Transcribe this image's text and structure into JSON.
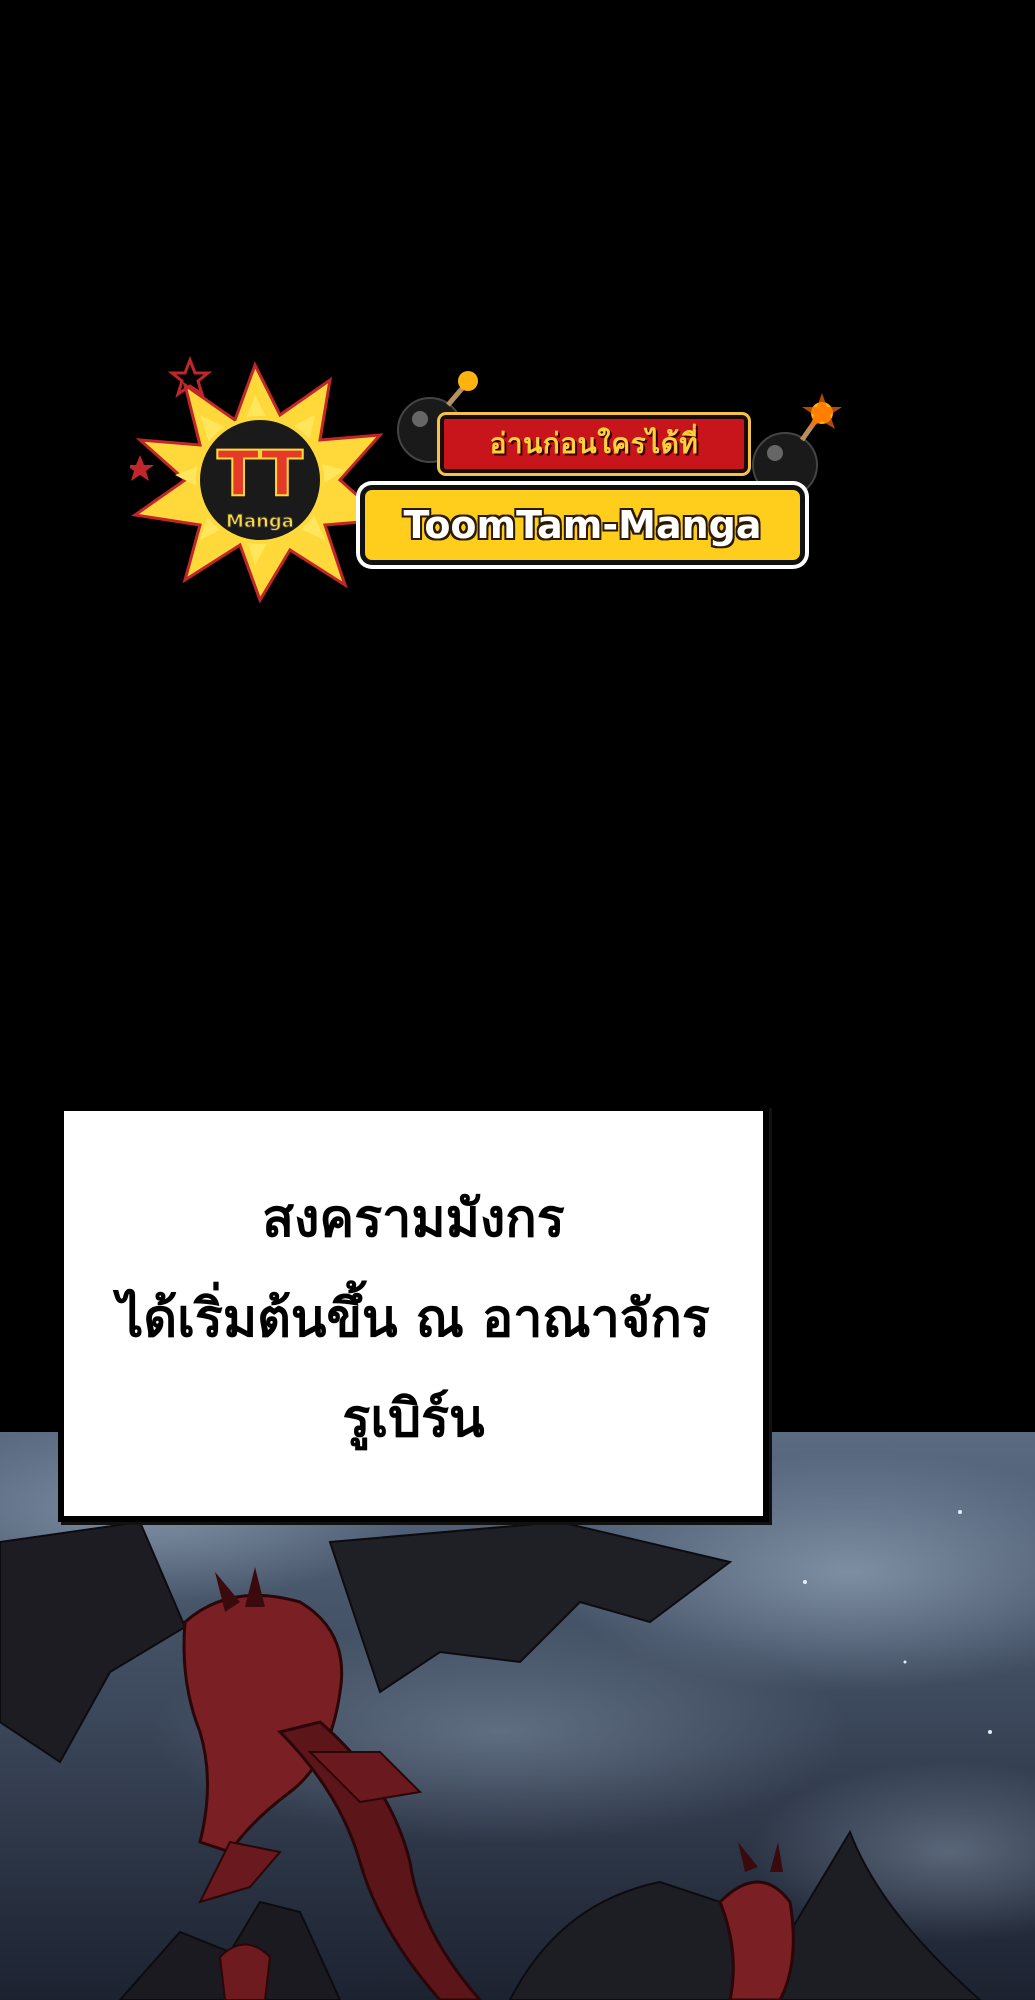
{
  "logo": {
    "emblem_text": "TT",
    "emblem_subtext": "Manga",
    "tagline": "อ่านก่อนใครได้ที่",
    "site_name": "ToomTam-Manga"
  },
  "caption": {
    "lines": [
      "สงครามมังกร",
      "ได้เริ่มต้นขึ้น ณ อาณาจักร",
      "รูเบิร์น"
    ]
  },
  "colors": {
    "background": "#000000",
    "plate_red": "#c8141b",
    "plate_yellow": "#ffcd1c",
    "sky_blue": "#5d6f86",
    "dragon_red": "#7a1f23"
  }
}
